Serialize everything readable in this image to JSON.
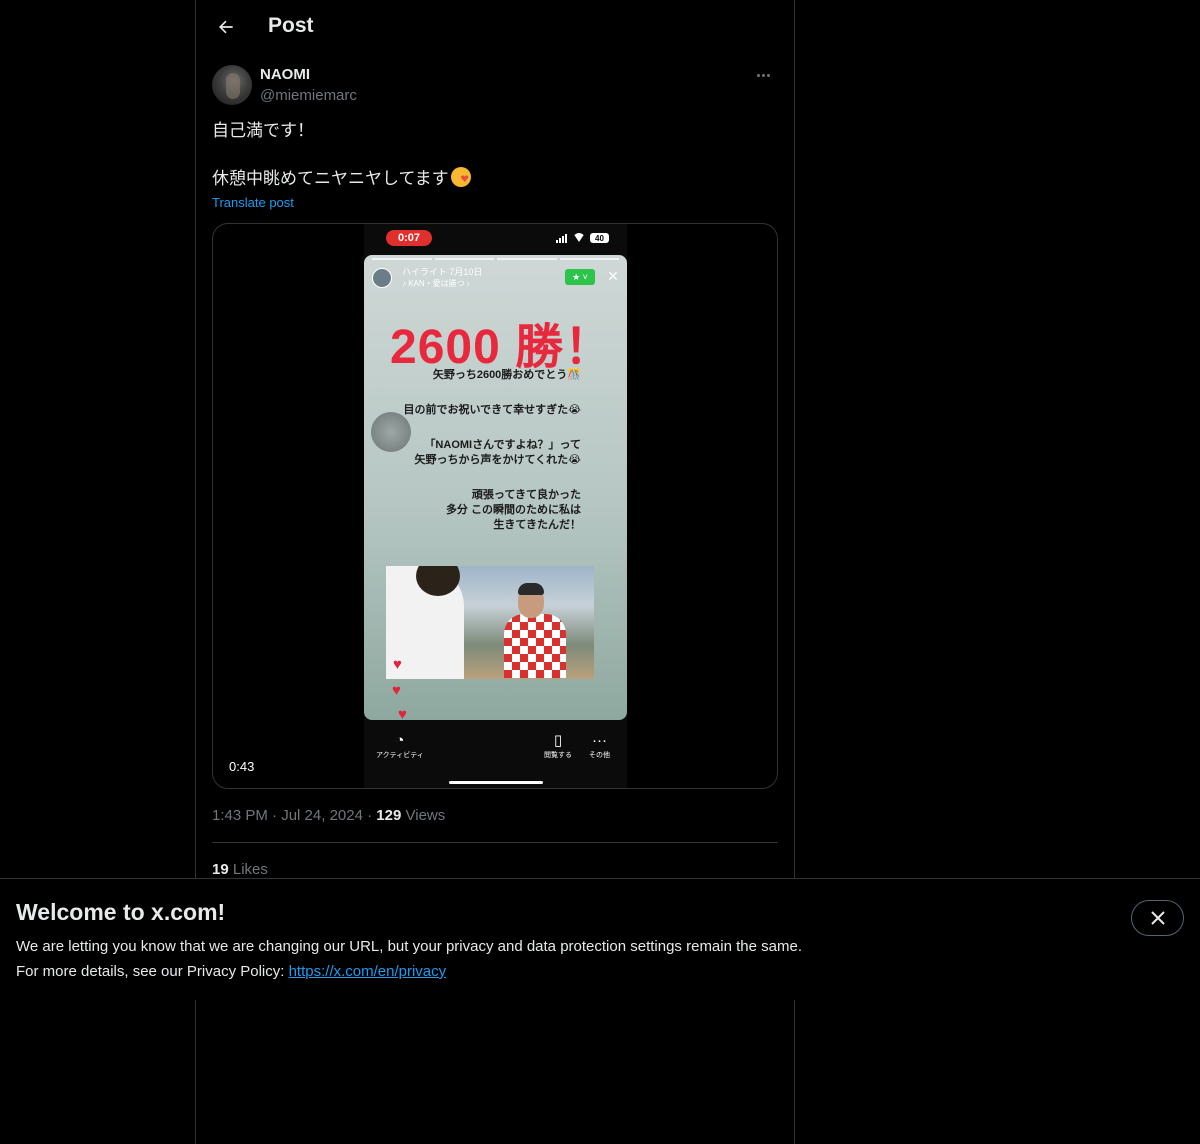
{
  "header": {
    "title": "Post",
    "back_icon": "arrow-left-icon"
  },
  "post": {
    "author": {
      "display_name": "NAOMI",
      "handle": "@miemiemarc"
    },
    "text_line1": "自己満です！",
    "text_line2": "休憩中眺めてニヤニヤしてます",
    "translate_label": "Translate post",
    "video": {
      "duration": "0:43",
      "screen": {
        "record_time": "0:07",
        "battery": "40",
        "story_title": "ハイライト  7月10日",
        "story_sub": "♪ KAN・愛は勝つ ›",
        "big_text": "2600 勝！",
        "lines": [
          "矢野っち2600勝おめでとう🎊",
          "目の前でお祝いできて幸せすぎた😭",
          "「NAOMIさんですよね？」って",
          "矢野っちから声をかけてくれた😭",
          "頑張ってきて良かった",
          "多分 この瞬間のために私は",
          "生きてきたんだ！"
        ],
        "bottom_bar": {
          "activity": "アクティビティ",
          "view": "閲覧する",
          "more": "その他"
        }
      }
    },
    "time": "1:43 PM",
    "date": "Jul 24, 2024",
    "views_count": "129",
    "views_label": "Views",
    "likes_count": "19",
    "likes_label": "Likes"
  },
  "banner": {
    "title": "Welcome to x.com!",
    "body_line1": "We are letting you know that we are changing our URL, but your privacy and data protection settings remain the same.",
    "body_prefix": "For more details, see our Privacy Policy: ",
    "link_text": "https://x.com/en/privacy"
  },
  "colors": {
    "accent": "#1d9bf0",
    "background": "#000000",
    "muted": "#71767b",
    "border": "#2f3336"
  }
}
